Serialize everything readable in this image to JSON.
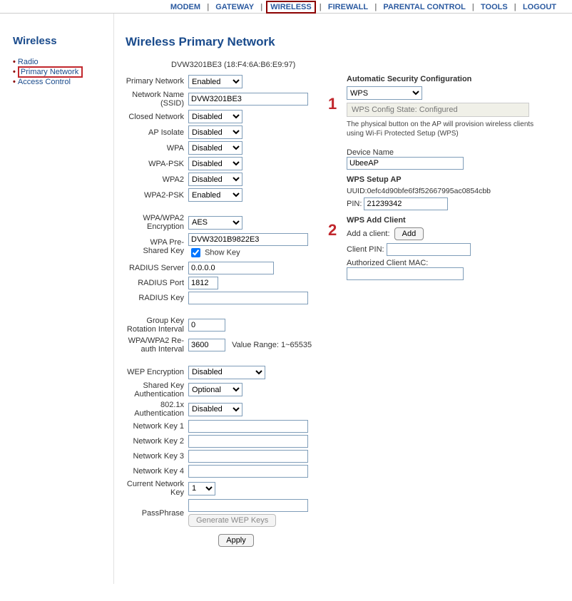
{
  "topnav": {
    "modem": "MODEM",
    "gateway": "GATEWAY",
    "wireless": "WIRELESS",
    "firewall": "FIREWALL",
    "parental": "PARENTAL CONTROL",
    "tools": "TOOLS",
    "logout": "LOGOUT"
  },
  "sidebar": {
    "title": "Wireless",
    "items": [
      {
        "label": "Radio"
      },
      {
        "label": "Primary Network"
      },
      {
        "label": "Access Control"
      }
    ]
  },
  "page_title": "Wireless Primary Network",
  "device_id": "DVW3201BE3 (18:F4:6A:B6:E9:97)",
  "labels": {
    "primary_network": "Primary Network",
    "ssid": "Network Name (SSID)",
    "closed": "Closed Network",
    "ap_isolate": "AP Isolate",
    "wpa": "WPA",
    "wpapsk": "WPA-PSK",
    "wpa2": "WPA2",
    "wpa2psk": "WPA2-PSK",
    "encryption": "WPA/WPA2 Encryption",
    "psk": "WPA Pre-Shared Key",
    "show_key": "Show Key",
    "radius_server": "RADIUS Server",
    "radius_port": "RADIUS Port",
    "radius_key": "RADIUS Key",
    "group_rotation": "Group Key Rotation Interval",
    "reauth": "WPA/WPA2 Re-auth Interval",
    "value_range": "Value Range: 1~65535",
    "wep_enc": "WEP Encryption",
    "shared_key_auth": "Shared Key Authentication",
    "dot1x": "802.1x Authentication",
    "nk1": "Network Key 1",
    "nk2": "Network Key 2",
    "nk3": "Network Key 3",
    "nk4": "Network Key 4",
    "current_nk": "Current Network Key",
    "passphrase": "PassPhrase",
    "gen_wep": "Generate WEP Keys",
    "apply": "Apply"
  },
  "values": {
    "primary_network": "Enabled",
    "ssid": "DVW3201BE3",
    "closed": "Disabled",
    "ap_isolate": "Disabled",
    "wpa": "Disabled",
    "wpapsk": "Disabled",
    "wpa2": "Disabled",
    "wpa2psk": "Enabled",
    "encryption": "AES",
    "psk": "DVW3201B9822E3",
    "radius_server": "0.0.0.0",
    "radius_port": "1812",
    "radius_key": "",
    "group_rotation": "0",
    "reauth": "3600",
    "wep_enc": "Disabled",
    "shared_key_auth": "Optional",
    "dot1x": "Disabled",
    "nk1": "",
    "nk2": "",
    "nk3": "",
    "nk4": "",
    "current_nk": "1",
    "passphrase": ""
  },
  "right": {
    "auto_sec": "Automatic Security Configuration",
    "wps_sel": "WPS",
    "wps_state": "WPS Config State: Configured",
    "note": "The physical button on the AP will provision wireless clients using Wi-Fi Protected Setup (WPS)",
    "device_name_lbl": "Device Name",
    "device_name": "UbeeAP",
    "setup_ap": "WPS Setup AP",
    "uuid": "UUID:0efc4d90bfe6f3f52667995ac0854cbb",
    "pin_lbl": "PIN:",
    "pin": "21239342",
    "add_client_heading": "WPS Add Client",
    "add_client_lbl": "Add a client:",
    "add_btn": "Add",
    "client_pin_lbl": "Client PIN:",
    "client_pin": "",
    "auth_mac_lbl": "Authorized Client MAC:",
    "auth_mac": ""
  },
  "annotations": {
    "one": "1",
    "two": "2"
  }
}
